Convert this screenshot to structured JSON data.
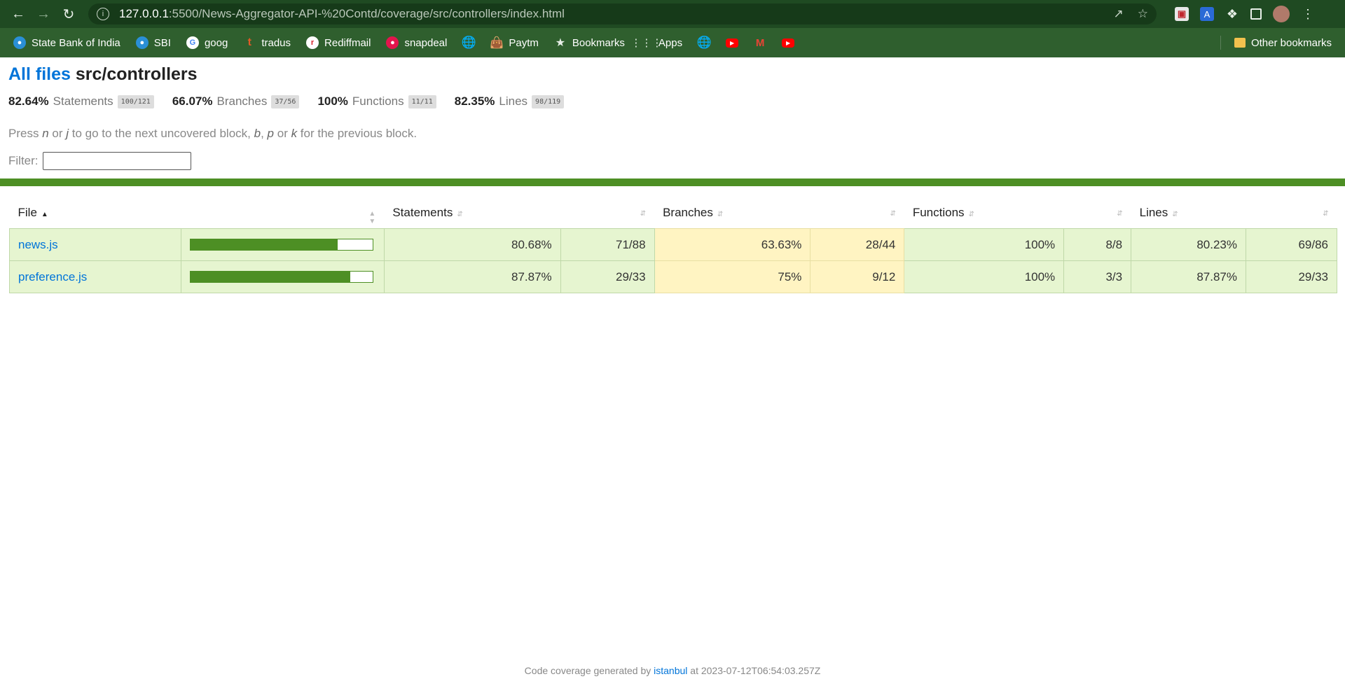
{
  "browser": {
    "url_host": "127.0.0.1",
    "url_path": ":5500/News-Aggregator-API-%20Contd/coverage/src/controllers/index.html",
    "bookmarks": [
      {
        "label": "State Bank of India",
        "icon": "sbi-icon"
      },
      {
        "label": "SBI",
        "icon": "sbi-icon"
      },
      {
        "label": "goog",
        "icon": "google-icon"
      },
      {
        "label": "tradus",
        "icon": "tradus-icon"
      },
      {
        "label": "Rediffmail",
        "icon": "rediff-icon"
      },
      {
        "label": "snapdeal",
        "icon": "snapdeal-icon"
      },
      {
        "label": "",
        "icon": "globe-icon"
      },
      {
        "label": "Paytm",
        "icon": "paytm-icon"
      },
      {
        "label": "Bookmarks",
        "icon": "star-icon"
      },
      {
        "label": "Apps",
        "icon": "apps-grid-icon"
      },
      {
        "label": "",
        "icon": "globe-icon"
      },
      {
        "label": "",
        "icon": "youtube-icon"
      },
      {
        "label": "",
        "icon": "gmail-icon"
      },
      {
        "label": "",
        "icon": "youtube-icon"
      }
    ],
    "other_bookmarks": "Other bookmarks"
  },
  "page": {
    "title_link": "All files",
    "title_dir": "src/controllers",
    "summary": [
      {
        "pct": "82.64%",
        "label": "Statements",
        "frac": "100/121"
      },
      {
        "pct": "66.07%",
        "label": "Branches",
        "frac": "37/56"
      },
      {
        "pct": "100%",
        "label": "Functions",
        "frac": "11/11"
      },
      {
        "pct": "82.35%",
        "label": "Lines",
        "frac": "98/119"
      }
    ],
    "hint": {
      "p1": "Press ",
      "k1": "n",
      "p2": " or ",
      "k2": "j",
      "p3": " to go to the next uncovered block, ",
      "k3": "b",
      "p4": ", ",
      "k4": "p",
      "p5": " or ",
      "k5": "k",
      "p6": " for the previous block."
    },
    "filter_label": "Filter:",
    "filter_value": ""
  },
  "table": {
    "headers": {
      "file": "File",
      "statements": "Statements",
      "branches": "Branches",
      "functions": "Functions",
      "lines": "Lines"
    },
    "rows": [
      {
        "file": "news.js",
        "coverage_fraction": 0.8068,
        "stmt_pct": "80.68%",
        "stmt_frac": "71/88",
        "br_pct": "63.63%",
        "br_frac": "28/44",
        "fn_pct": "100%",
        "fn_frac": "8/8",
        "ln_pct": "80.23%",
        "ln_frac": "69/86"
      },
      {
        "file": "preference.js",
        "coverage_fraction": 0.8787,
        "stmt_pct": "87.87%",
        "stmt_frac": "29/33",
        "br_pct": "75%",
        "br_frac": "9/12",
        "fn_pct": "100%",
        "fn_frac": "3/3",
        "ln_pct": "87.87%",
        "ln_frac": "29/33"
      }
    ]
  },
  "footer": {
    "prefix": "Code coverage generated by ",
    "link": "istanbul",
    "suffix": " at 2023-07-12T06:54:03.257Z"
  },
  "colors": {
    "high": "#e6f5d0",
    "medium": "#fff4c2",
    "bar": "#4d8f24",
    "chrome": "#1f4a22"
  }
}
